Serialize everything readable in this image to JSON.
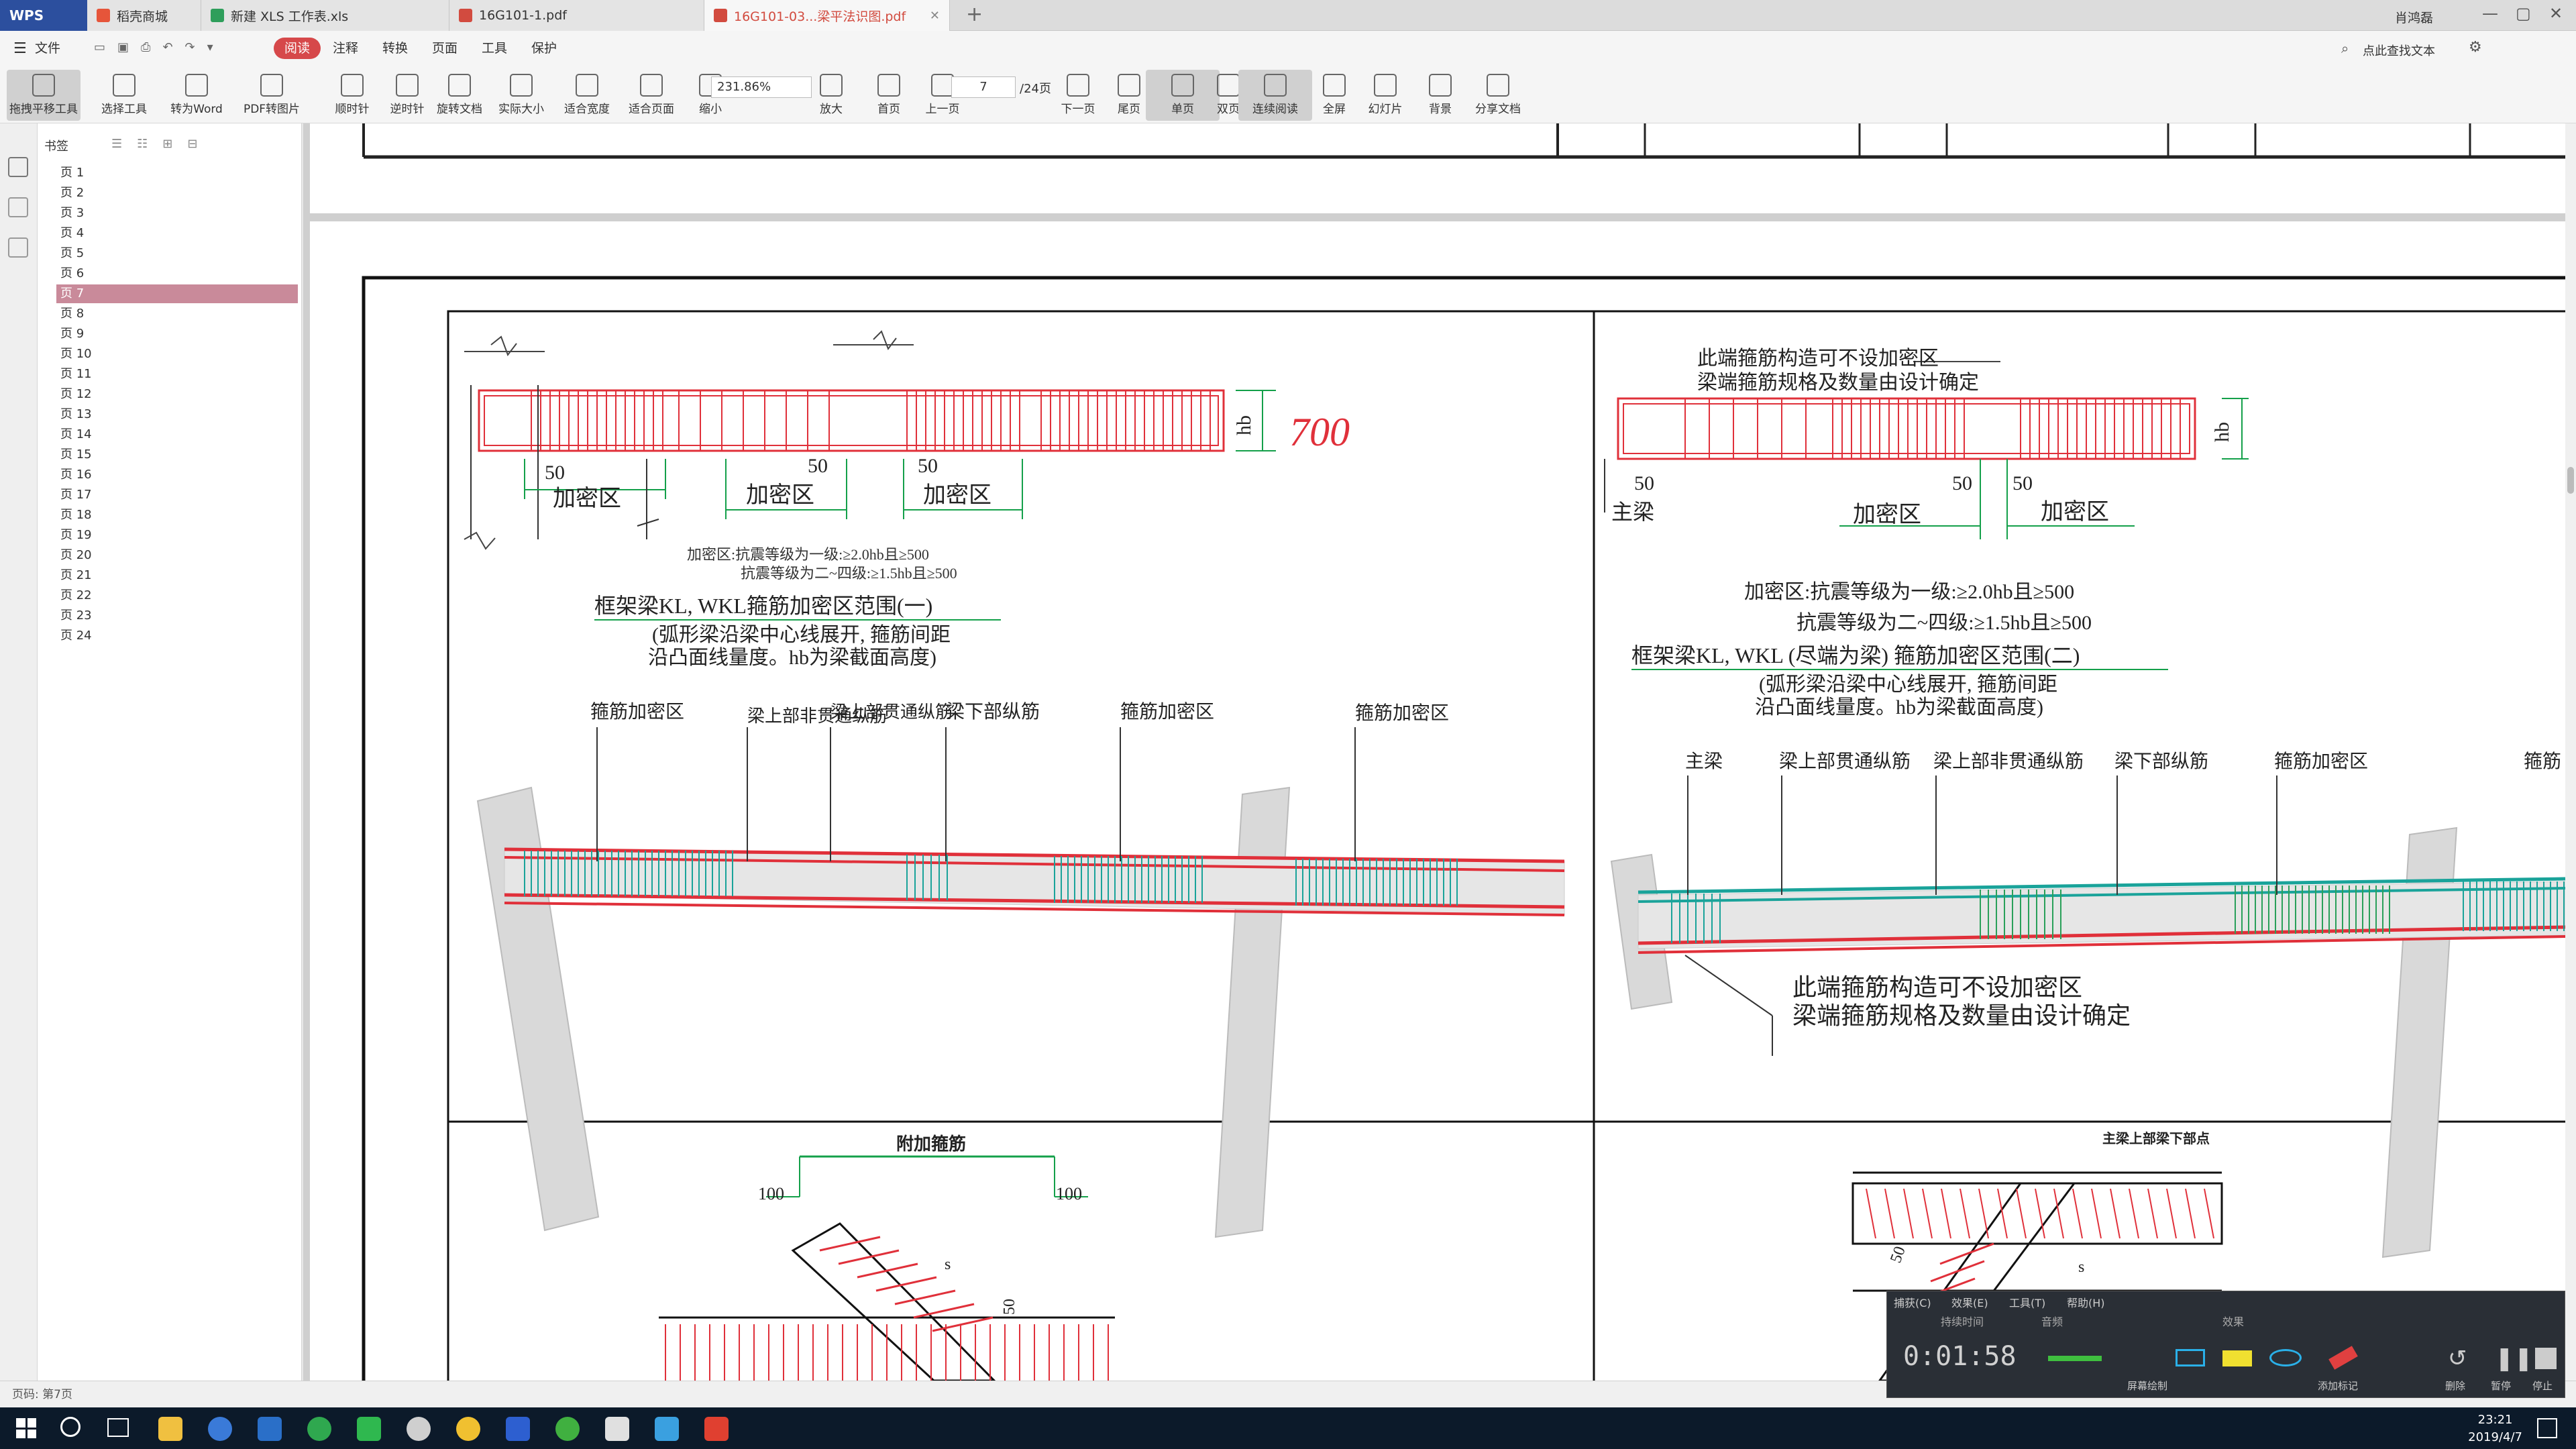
{
  "titlebar": {
    "logo": "WPS",
    "tabs": [
      {
        "label": "稻壳商城",
        "icon": "wps-orange-icon",
        "color": "#e6553a"
      },
      {
        "label": "新建 XLS 工作表.xls",
        "icon": "spreadsheet-icon",
        "color": "#2e9e5b"
      },
      {
        "label": "16G101-1.pdf",
        "icon": "pdf-icon",
        "color": "#d24b3f"
      },
      {
        "label": "16G101-03...梁平法识图.pdf",
        "icon": "pdf-icon",
        "color": "#d24b3f"
      }
    ],
    "user": "肖鸿磊"
  },
  "menubar": {
    "file": "文件",
    "items": [
      "阅读",
      "注释",
      "转换",
      "页面",
      "工具",
      "保护"
    ],
    "active": "阅读",
    "search_hint": "点此查找文本"
  },
  "toolbar": {
    "tools": [
      {
        "label": "拖拽平移工具",
        "icon": "hand-icon",
        "on": true
      },
      {
        "label": "选择工具",
        "icon": "cursor-icon"
      },
      {
        "label": "转为Word",
        "icon": "word-convert-icon"
      },
      {
        "label": "PDF转图片",
        "icon": "pdf-image-icon"
      },
      {
        "label": "顺时针",
        "icon": "rotate-cw-icon"
      },
      {
        "label": "逆时针",
        "icon": "rotate-ccw-icon"
      },
      {
        "label": "旋转文档",
        "icon": "rotate-doc-icon"
      },
      {
        "label": "实际大小",
        "icon": "actual-size-icon"
      },
      {
        "label": "适合宽度",
        "icon": "fit-width-icon"
      },
      {
        "label": "适合页面",
        "icon": "fit-page-icon"
      },
      {
        "label": "缩小",
        "icon": "zoom-out-icon"
      },
      {
        "label": "放大",
        "icon": "zoom-in-icon"
      },
      {
        "label": "首页",
        "icon": "first-page-icon"
      },
      {
        "label": "上一页",
        "icon": "prev-page-icon"
      },
      {
        "label": "下一页",
        "icon": "next-page-icon"
      },
      {
        "label": "尾页",
        "icon": "last-page-icon"
      },
      {
        "label": "单页",
        "icon": "single-page-icon",
        "on": true
      },
      {
        "label": "双页",
        "icon": "double-page-icon"
      },
      {
        "label": "连续阅读",
        "icon": "continuous-icon",
        "on": true
      },
      {
        "label": "全屏",
        "icon": "fullscreen-icon"
      },
      {
        "label": "幻灯片",
        "icon": "slideshow-icon"
      },
      {
        "label": "背景",
        "icon": "background-icon"
      },
      {
        "label": "分享文档",
        "icon": "share-icon"
      }
    ],
    "zoom": "231.86%",
    "page": "7",
    "page_total": "/24页"
  },
  "bookmarks": {
    "header": "书签",
    "items": [
      "页 1",
      "页 2",
      "页 3",
      "页 4",
      "页 5",
      "页 6",
      "页 7",
      "页 8",
      "页 9",
      "页 10",
      "页 11",
      "页 12",
      "页 13",
      "页 14",
      "页 15",
      "页 16",
      "页 17",
      "页 18",
      "页 19",
      "页 20",
      "页 21",
      "页 22",
      "页 23",
      "页 24"
    ],
    "selected": "页 7"
  },
  "drawing": {
    "left": {
      "handwritten": "700",
      "hb": "hb",
      "dim50": "50",
      "zone": "加密区",
      "note1": "加密区:抗震等级为一级:≥2.0hb且≥500",
      "note2": "抗震等级为二~四级:≥1.5hb且≥500",
      "title": "框架梁KL, WKL箍筋加密区范围(一)",
      "sub1": "(弧形梁沿梁中心线展开, 箍筋间距",
      "sub2": "沿凸面线量度。hb为梁截面高度)",
      "labels": [
        "箍筋加密区",
        "梁上部非贯通纵筋",
        "梁上部贯通纵筋",
        "梁下部纵筋",
        "箍筋加密区",
        "箍筋加密区"
      ]
    },
    "right": {
      "note_top1": "此端箍筋构造可不设加密区",
      "note_top2": "梁端箍筋规格及数量由设计确定",
      "hb": "hb",
      "dim50": "50",
      "main_beam": "主梁",
      "zone": "加密区",
      "note1": "加密区:抗震等级为一级:≥2.0hb且≥500",
      "note2": "抗震等级为二~四级:≥1.5hb且≥500",
      "title": "框架梁KL, WKL (尽端为梁) 箍筋加密区范围(二)",
      "sub1": "(弧形梁沿梁中心线展开, 箍筋间距",
      "sub2": "沿凸面线量度。hb为梁截面高度)",
      "labels": [
        "主梁",
        "梁上部贯通纵筋",
        "梁上部非贯通纵筋",
        "梁下部纵筋",
        "箍筋加密区",
        "箍筋"
      ],
      "note_3d1": "此端箍筋构造可不设加密区",
      "note_3d2": "梁端箍筋规格及数量由设计确定"
    },
    "bottom_left": {
      "title": "附加箍筋",
      "dim100": "100",
      "s": "s",
      "dim50": "50"
    },
    "bottom_right": {
      "title": "主梁上部梁下部点",
      "s": "s",
      "dim50": "50"
    }
  },
  "status": {
    "page_label": "页码: 第7页"
  },
  "recorder": {
    "menu": [
      "捕获(C)",
      "效果(E)",
      "工具(T)",
      "帮助(H)"
    ],
    "sections": [
      "持续时间",
      "音频",
      "效果"
    ],
    "time": "0:01:58",
    "buttons": [
      "屏幕绘制",
      "添加标记",
      "删除",
      "暂停",
      "停止"
    ]
  },
  "taskbar": {
    "time": "23:21",
    "date": "2019/4/7"
  },
  "colors": {
    "accent": "#d6484a",
    "rebar_red": "#e0303a",
    "stirrup_teal": "#1aa39a",
    "dim_green": "#14a04a"
  }
}
